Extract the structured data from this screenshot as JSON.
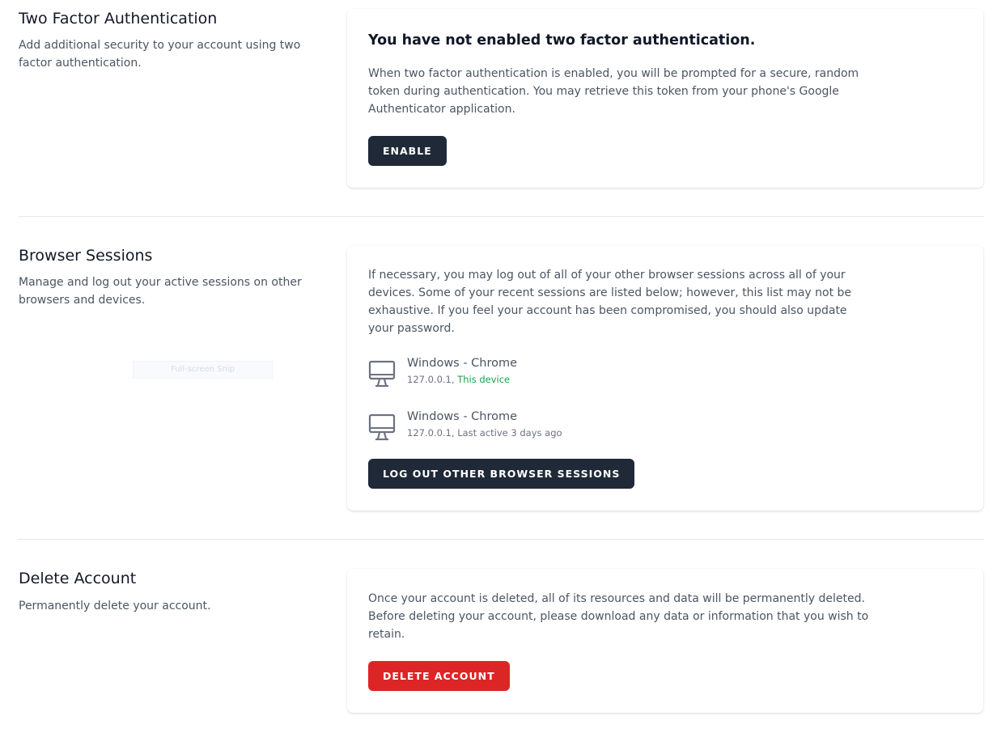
{
  "two_factor": {
    "title": "Two Factor Authentication",
    "description": "Add additional security to your account using two factor authentication.",
    "heading": "You have not enabled two factor authentication.",
    "text": "When two factor authentication is enabled, you will be prompted for a secure, random token during authentication. You may retrieve this token from your phone's Google Authenticator application.",
    "button": "Enable"
  },
  "browser_sessions": {
    "title": "Browser Sessions",
    "description": "Manage and log out your active sessions on other browsers and devices.",
    "text": "If necessary, you may log out of all of your other browser sessions across all of your devices. Some of your recent sessions are listed below; however, this list may not be exhaustive. If you feel your account has been compromised, you should also update your password.",
    "sessions": [
      {
        "device": "Windows - Chrome",
        "ip": "127.0.0.1,",
        "status": "This device",
        "icon": "desktop-icon"
      },
      {
        "device": "Windows - Chrome",
        "ip": "127.0.0.1,",
        "status": "Last active 3 days ago",
        "icon": "desktop-icon"
      }
    ],
    "button": "Log Out Other Browser Sessions"
  },
  "snip_overlay": {
    "label": "Full-screen Snip"
  },
  "delete_account": {
    "title": "Delete Account",
    "description": "Permanently delete your account.",
    "text": "Once your account is deleted, all of its resources and data will be permanently deleted. Before deleting your account, please download any data or information that you wish to retain.",
    "button": "Delete Account"
  },
  "colors": {
    "dark_button": "#1f2937",
    "danger_button": "#dc2626",
    "this_device": "#16a34a"
  }
}
